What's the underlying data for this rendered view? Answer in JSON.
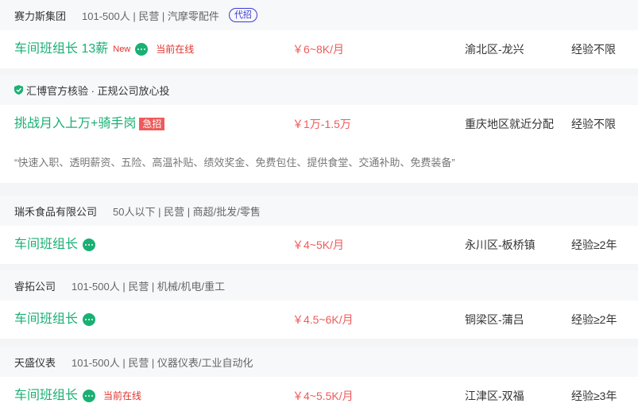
{
  "jobs": [
    {
      "company": "赛力斯集团",
      "meta": "101-500人 | 民营 | 汽摩零配件",
      "badge": "代招",
      "title": "车间班组长 13薪",
      "new": "New",
      "online": "当前在线",
      "salary": "￥6~8K/月",
      "location": "渝北区-龙兴",
      "experience": "经验不限"
    },
    {
      "company": "汇博官方核验 · 正规公司放心投",
      "title": "挑战月入上万+骑手岗",
      "urgent": "急招",
      "salary": "￥1万-1.5万",
      "location": "重庆地区就近分配",
      "experience": "经验不限",
      "description": "“快速入职、透明薪资、五险、高温补贴、绩效奖金、免费包住、提供食堂、交通补助、免费装备”"
    },
    {
      "company": "瑞禾食品有限公司",
      "meta": "50人以下 | 民营 | 商超/批发/零售",
      "title": "车间班组长",
      "salary": "￥4~5K/月",
      "location": "永川区-板桥镇",
      "experience": "经验≥2年"
    },
    {
      "company": "睿拓公司",
      "meta": "101-500人 | 民营 | 机械/机电/重工",
      "title": "车间班组长",
      "salary": "￥4.5~6K/月",
      "location": "铜梁区-蒲吕",
      "experience": "经验≥2年"
    },
    {
      "company": "天盛仪表",
      "meta": "101-500人 | 民营 | 仪器仪表/工业自动化",
      "title": "车间班组长",
      "online": "当前在线",
      "salary": "￥4~5.5K/月",
      "location": "江津区-双福",
      "experience": "经验≥3年"
    }
  ],
  "icons": {
    "chat": "chat-bubble-icon",
    "verified": "shield-check-icon"
  },
  "colors": {
    "title": "#1ab074",
    "salary": "#ef5a5a",
    "online": "#e0322d",
    "badge": "#3c3ccf"
  }
}
